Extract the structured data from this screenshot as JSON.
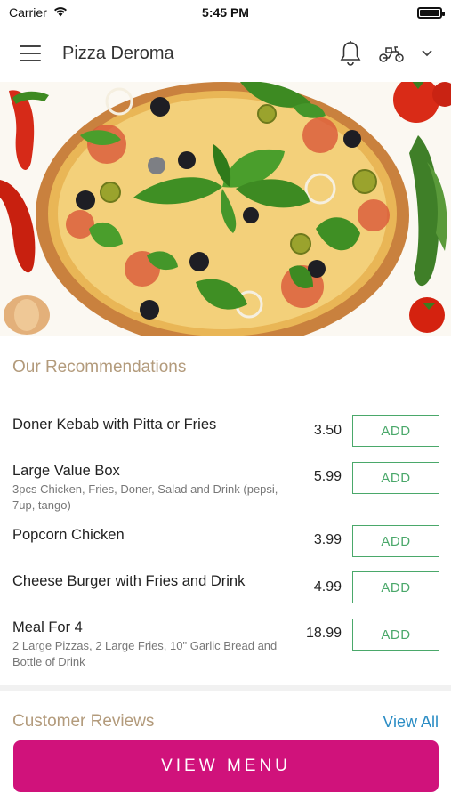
{
  "status_bar": {
    "carrier": "Carrier",
    "time": "5:45 PM"
  },
  "header": {
    "title": "Pizza Deroma"
  },
  "recommendations": {
    "title": "Our Recommendations",
    "items": [
      {
        "name": "Doner Kebab with Pitta or Fries",
        "desc": "",
        "price": "3.50",
        "add_label": "ADD"
      },
      {
        "name": "Large Value Box",
        "desc": "3pcs Chicken, Fries, Doner, Salad and Drink (pepsi, 7up, tango)",
        "price": "5.99",
        "add_label": "ADD"
      },
      {
        "name": "Popcorn Chicken",
        "desc": "",
        "price": "3.99",
        "add_label": "ADD"
      },
      {
        "name": "Cheese Burger with Fries and Drink",
        "desc": "",
        "price": "4.99",
        "add_label": "ADD"
      },
      {
        "name": "Meal For 4",
        "desc": "2 Large Pizzas, 2 Large Fries, 10\" Garlic Bread and Bottle of Drink",
        "price": "18.99",
        "add_label": "ADD"
      }
    ]
  },
  "reviews": {
    "title": "Customer Reviews",
    "view_all_label": "View All"
  },
  "cta": {
    "label": "VIEW MENU"
  },
  "colors": {
    "accent": "#d0127b",
    "add_green": "#4aa86a",
    "section_title": "#b39b7c",
    "link": "#2a8cc4"
  }
}
